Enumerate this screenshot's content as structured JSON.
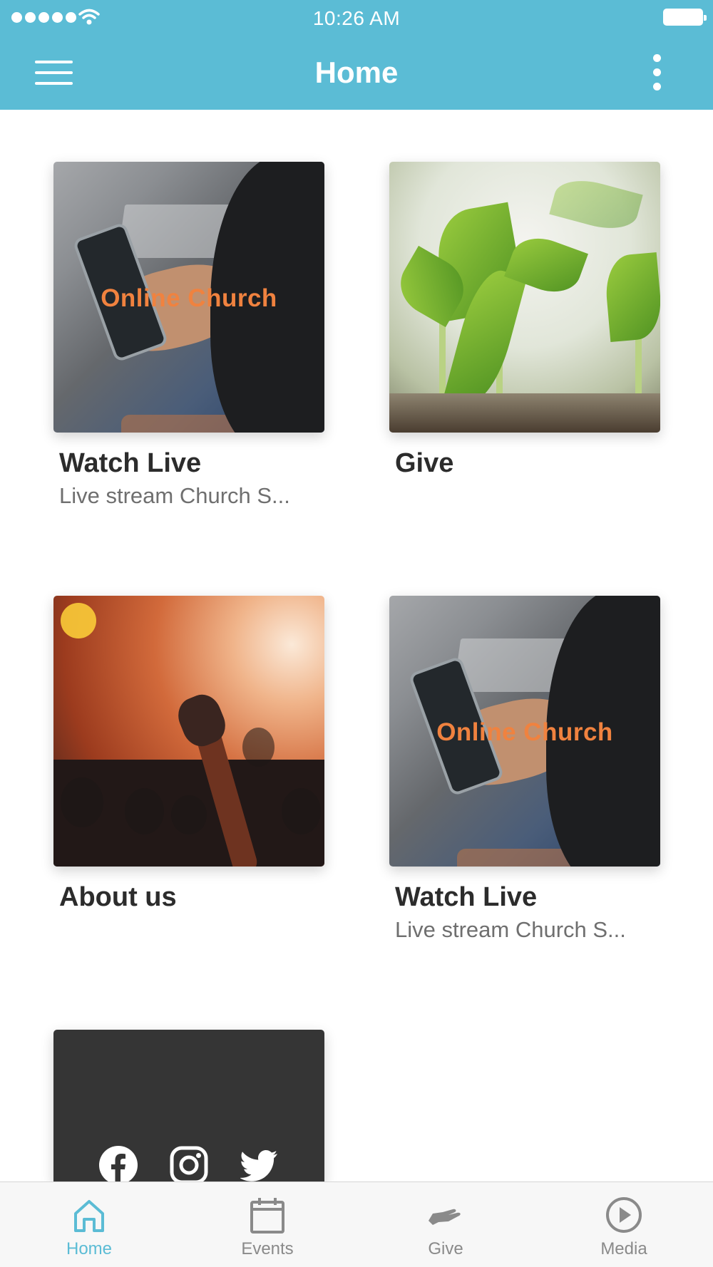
{
  "status_bar": {
    "time": "10:26 AM"
  },
  "nav": {
    "title": "Home",
    "menu_icon": "hamburger-menu-icon",
    "more_icon": "more-vertical-icon"
  },
  "tiles": [
    {
      "title": "Watch Live",
      "subtitle": "Live stream Church S...",
      "overlay_text": "Online Church",
      "image": "person-holding-phone"
    },
    {
      "title": "Give",
      "image": "seedling-plants"
    },
    {
      "title": "About us",
      "image": "worship-concert"
    },
    {
      "title": "Watch Live",
      "subtitle": "Live stream Church S...",
      "overlay_text": "Online Church",
      "image": "person-holding-phone"
    }
  ],
  "social": {
    "icons": [
      "facebook-icon",
      "instagram-icon",
      "twitter-icon"
    ]
  },
  "tab_bar": {
    "tabs": [
      {
        "label": "Home",
        "icon": "home-icon",
        "active": true
      },
      {
        "label": "Events",
        "icon": "calendar-icon",
        "active": false
      },
      {
        "label": "Give",
        "icon": "give-hand-icon",
        "active": false
      },
      {
        "label": "Media",
        "icon": "play-circle-icon",
        "active": false
      }
    ]
  },
  "colors": {
    "brand": "#5bbcd5",
    "overlay_text": "#f0823f",
    "social_tile": "#353535",
    "tab_inactive": "#8a8a8a"
  }
}
